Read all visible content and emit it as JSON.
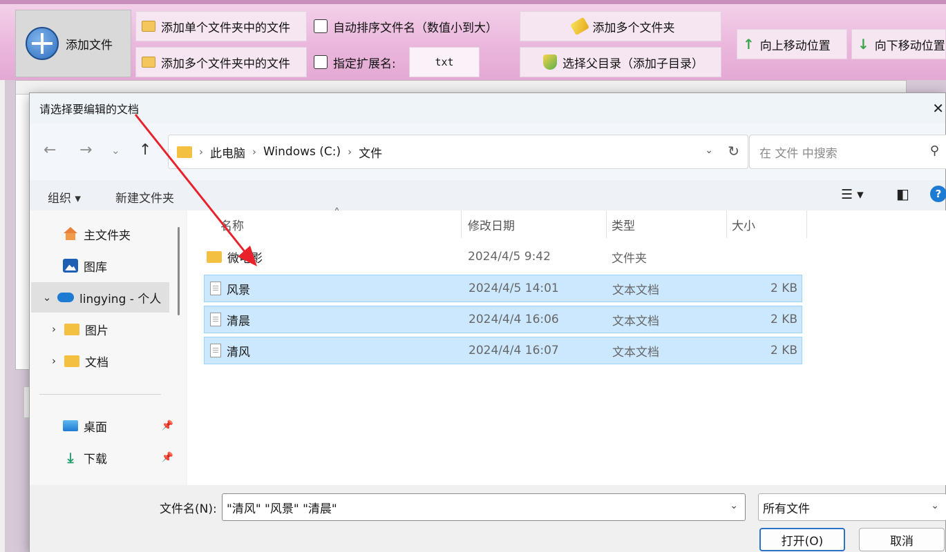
{
  "app": {
    "add_file": "添加文件",
    "add_single_folder": "添加单个文件夹中的文件",
    "add_multi_folder": "添加多个文件夹中的文件",
    "auto_sort": "自动排序文件名（数值小到大）",
    "specify_ext": "指定扩展名:",
    "ext_value": "txt",
    "add_multi_folders": "添加多个文件夹",
    "select_parent": "选择父目录（添加子目录）",
    "move_up": "向上移动位置",
    "move_down": "向下移动位置"
  },
  "dialog": {
    "title": "请选择要编辑的文档",
    "breadcrumb": [
      "此电脑",
      "Windows (C:)",
      "文件"
    ],
    "search_placeholder": "在 文件 中搜索",
    "organize": "组织 ▾",
    "new_folder": "新建文件夹",
    "nav_items": [
      {
        "label": "主文件夹"
      },
      {
        "label": "图库"
      },
      {
        "label": "lingying - 个人"
      },
      {
        "label": "图片"
      },
      {
        "label": "文档"
      },
      {
        "label": "桌面"
      },
      {
        "label": "下载"
      }
    ],
    "columns": {
      "name": "名称",
      "modified": "修改日期",
      "type": "类型",
      "size": "大小"
    },
    "files": [
      {
        "name": "微电影",
        "modified": "2024/4/5 9:42",
        "type": "文件夹",
        "size": ""
      },
      {
        "name": "风景",
        "modified": "2024/4/5 14:01",
        "type": "文本文档",
        "size": "2 KB"
      },
      {
        "name": "清晨",
        "modified": "2024/4/4 16:06",
        "type": "文本文档",
        "size": "2 KB"
      },
      {
        "name": "清风",
        "modified": "2024/4/4 16:07",
        "type": "文本文档",
        "size": "2 KB"
      }
    ],
    "filename_label": "文件名(N):",
    "filename_value": "\"清风\" \"风景\" \"清晨\"",
    "filetype_value": "所有文件",
    "open_button": "打开(O)",
    "cancel_button": "取消"
  },
  "colors": {
    "annotation_arrow": "#e8212b",
    "selection": "#cce8ff",
    "accent": "#2b71c4"
  }
}
